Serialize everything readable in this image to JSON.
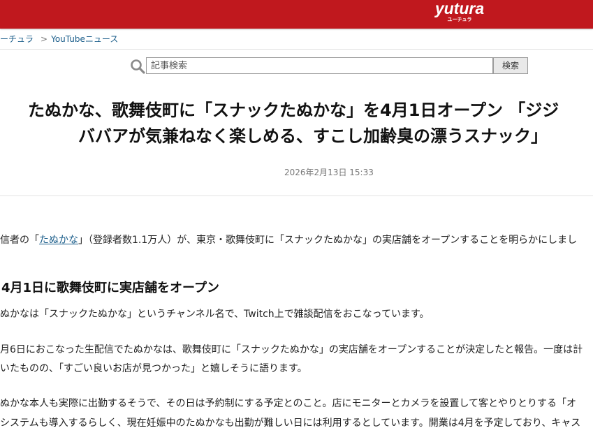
{
  "header": {
    "logo_text": "yutura",
    "logo_subtext": "ユーチュラ",
    "color": "#c0181e"
  },
  "breadcrumb": {
    "items": [
      "ユーチュラ",
      "YouTubeニュース"
    ],
    "separator": ">"
  },
  "search": {
    "placeholder": "記事検索",
    "button_label": "検索",
    "icon": "search-icon"
  },
  "article": {
    "title_line1": "たぬかな、歌舞伎町に「スナックたぬかな」を4月1日オープン 「ジジ",
    "title_line2": "ババアが気兼ねなく楽しめる、すこし加齢臭の漂うスナック」",
    "date": "2026年2月13日 15:33",
    "intro_prefix": "信者の「",
    "intro_link": "たぬかな",
    "intro_suffix": "」（登録者数1.1万人）が、東京・歌舞伎町に「スナックたぬかな」の実店舗をオープンすることを明らかにしまし",
    "section_heading": "4月1日に歌舞伎町に実店舗をオープン",
    "paragraphs": [
      "ぬかなは「スナックたぬかな」というチャンネル名で、Twitch上で雑談配信をおこなっています。",
      "月6日におこなった生配信でたぬかなは、歌舞伎町に「スナックたぬかな」の実店舗をオープンすることが決定したと報告。一度は計",
      "いたものの、「すごい良いお店が見つかった」と嬉しそうに語ります。",
      "ぬかな本人も実際に出勤するそうで、その日は予約制にする予定とのこと。店にモニターとカメラを設置して客とやりとりする「オ",
      "システムも導入するらしく、現在妊娠中のたぬかなも出勤が難しい日には利用するとしています。開業は4月を予定しており、キャス"
    ]
  }
}
